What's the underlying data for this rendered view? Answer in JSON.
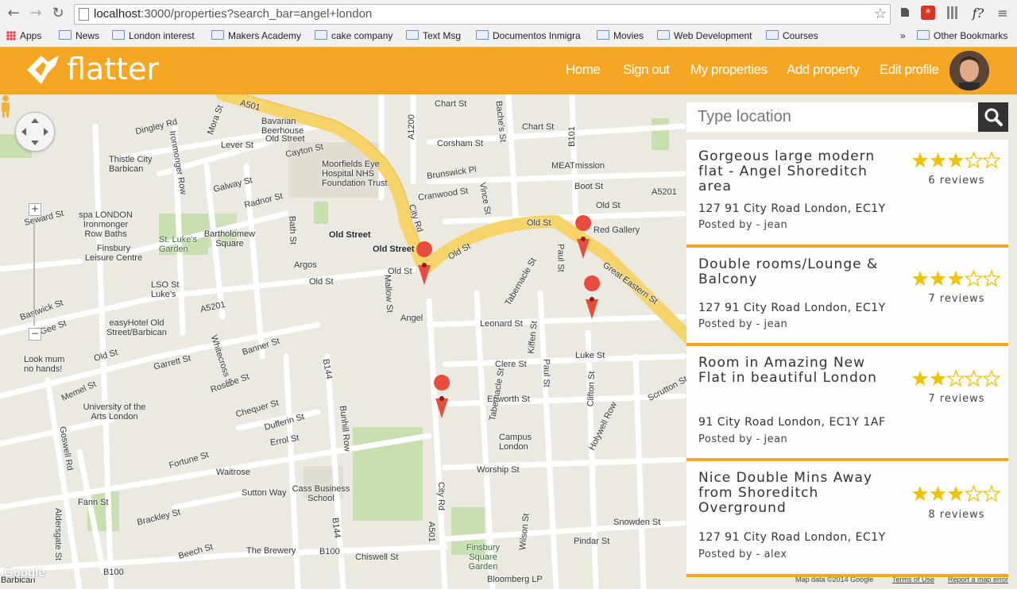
{
  "browser": {
    "url_host": "localhost",
    "url_path": ":3000/properties?search_bar=angel+london",
    "bookmarks": [
      {
        "label": "Apps",
        "type": "apps"
      },
      {
        "label": "News",
        "type": "folder"
      },
      {
        "label": "London interest",
        "type": "folder"
      },
      {
        "label": "Makers Academy",
        "type": "folder"
      },
      {
        "label": "cake company",
        "type": "folder"
      },
      {
        "label": "Text Msg",
        "type": "folder"
      },
      {
        "label": "Documentos Inmigra",
        "type": "folder"
      },
      {
        "label": "Movies",
        "type": "folder"
      },
      {
        "label": "Web Development",
        "type": "folder"
      },
      {
        "label": "Courses",
        "type": "folder"
      },
      {
        "label": "»",
        "type": "overflow"
      },
      {
        "label": "Other Bookmarks",
        "type": "folder"
      }
    ],
    "extensions_icons": [
      "evernote-icon",
      "lastpass-icon",
      "columns-icon",
      "fontface-icon",
      "menu-icon"
    ],
    "ext_font_label": "f?"
  },
  "header": {
    "brand": "flatter",
    "brand_color": "#f5a623",
    "nav": [
      "Home",
      "Sign out",
      "My properties",
      "Add property",
      "Edit profile"
    ]
  },
  "search": {
    "placeholder": "Type location"
  },
  "listings": [
    {
      "title": "Gorgeous large modern flat - Angel Shoreditch area",
      "address": "127 91 City Road London, EC1Y",
      "posted": "Posted by - jean",
      "rating": 3,
      "reviews": "6 reviews"
    },
    {
      "title": "Double rooms/Lounge & Balcony",
      "address": "127 91 City Road London, EC1Y",
      "posted": "Posted by - jean",
      "rating": 3,
      "reviews": "7 reviews"
    },
    {
      "title": "Room in Amazing New Flat in beautiful London",
      "address": "91 City Road London, EC1Y 1AF",
      "posted": "Posted by - jean",
      "rating": 2,
      "reviews": "7 reviews"
    },
    {
      "title": "Nice Double Mins Away from Shoreditch Overground",
      "address": "127 91 City Road London, EC1Y",
      "posted": "Posted by - alex",
      "rating": 3,
      "reviews": "8 reviews"
    }
  ],
  "map": {
    "labels": {
      "bavarian": "Bavarian Beerhouse",
      "oldstreet_1": "Old Street",
      "moorfields": "Moorfields Eye Hospital NHS Foundation Trust",
      "dingley": "Dingley Rd",
      "lever": "Lever St",
      "thistle": "Thistle City Barbican",
      "galway": "Galway St",
      "spa": "spa LONDON Ironmonger Row Baths",
      "finsbury_leisure": "Finsbury Leisure Centre",
      "stlukes_garden": "St. Luke's Garden",
      "bartholomew": "Bartholomew Square",
      "oldstreet_station": "Old Street",
      "oldstreet_sign2": "Old Street",
      "argos": "Argos",
      "lso": "LSO St Luke's",
      "easyhotel": "easyHotel Old Street/Barbican",
      "lookmum": "Look mum no hands!",
      "memel": "Memel St",
      "univarts": "University of the Arts London",
      "goswell": "Goswell Rd",
      "fortune": "Fortune St",
      "waitrose": "Waitrose",
      "sutton": "Sutton Way",
      "cass": "Cass Business School",
      "fann": "Fann St",
      "brackley": "Brackley St",
      "beech": "Beech St",
      "thebrewery": "The Brewery",
      "chiswell": "Chiswell St",
      "bloomberg": "Bloomberg LP",
      "finsburysq": "Finsbury Square Garden",
      "worship": "Worship St",
      "campus": "Campus London",
      "epworth": "Epworth St",
      "clere": "Clere St",
      "luke": "Luke St",
      "leonard": "Leonard St",
      "angel": "Angel",
      "redgallery": "Red Gallery",
      "meatmission": "MEATmission",
      "chartst_1": "Chart St",
      "chartst_2": "Chart St",
      "corsham": "Corsham St",
      "brunswick": "Brunswick Pl",
      "cranwood": "Cranwood St",
      "boot": "Boot St",
      "greateastern": "Great Eastern St",
      "cityrd": "City Rd",
      "a501": "A501",
      "a1200": "A1200",
      "a5201": "A5201",
      "a5201_2": "A5201",
      "b101": "B101",
      "b144": "B144",
      "b100": "B100",
      "bunhill": "Bunhill Row",
      "whitecross": "Whitecross St",
      "banner": "Banner St",
      "garrett": "Garrett St",
      "roscoe": "Roscoe St",
      "chequer": "Chequer St",
      "dufferin": "Dufferin St",
      "errol": "Errol St",
      "bath": "Bath St",
      "radnor": "Radnor St",
      "cayton": "Cayton St",
      "seward": "Seward St",
      "bastwick": "Bastwick St",
      "gee": "Gee St",
      "mora": "Mora St",
      "ironmonger": "Ironmonger Row",
      "paul": "Paul St",
      "tabernacle": "Tabernacle St",
      "kiffen": "Kiffen St",
      "clifton": "Clifton St",
      "holywell": "Holywell Row",
      "scrutton": "Scrutton St",
      "wilson": "Wilson St",
      "pindar": "Pindar St",
      "snowden": "Snowden St",
      "oldst_main": "Old St",
      "oldst_2": "Old St",
      "oldst_3": "Old St",
      "oldst_4": "Old St",
      "vince": "Vince St",
      "bache": "Bache's St",
      "mallow": "Mallow St",
      "aldersgate": "Aldersgate St",
      "barbican": "Barbican",
      "google": "Google",
      "mapdata": "Map data ©2014 Google",
      "terms": "Terms of Use",
      "report": "Report a map error"
    }
  }
}
